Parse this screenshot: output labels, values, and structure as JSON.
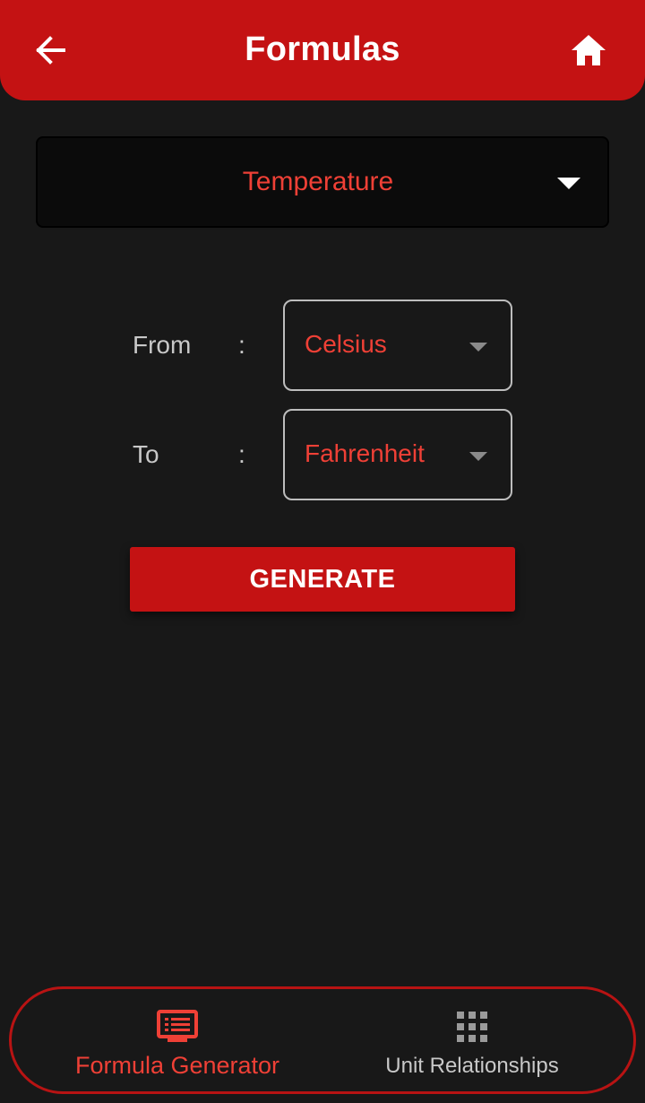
{
  "appbar": {
    "title": "Formulas",
    "back_icon": "arrow-left-icon",
    "home_icon": "home-icon"
  },
  "category": {
    "selected": "Temperature"
  },
  "converter": {
    "from_label": "From",
    "to_label": "To",
    "separator": ":",
    "from_value": "Celsius",
    "to_value": "Fahrenheit"
  },
  "actions": {
    "generate_label": "GENERATE"
  },
  "bottom_nav": {
    "items": [
      {
        "label": "Formula Generator",
        "icon": "formula-list-icon",
        "active": true
      },
      {
        "label": "Unit Relationships",
        "icon": "grid-icon",
        "active": false
      }
    ]
  },
  "colors": {
    "accent": "#c41213",
    "accent_text": "#ef4036",
    "background": "#181818",
    "inactive": "#c8c8c8"
  }
}
